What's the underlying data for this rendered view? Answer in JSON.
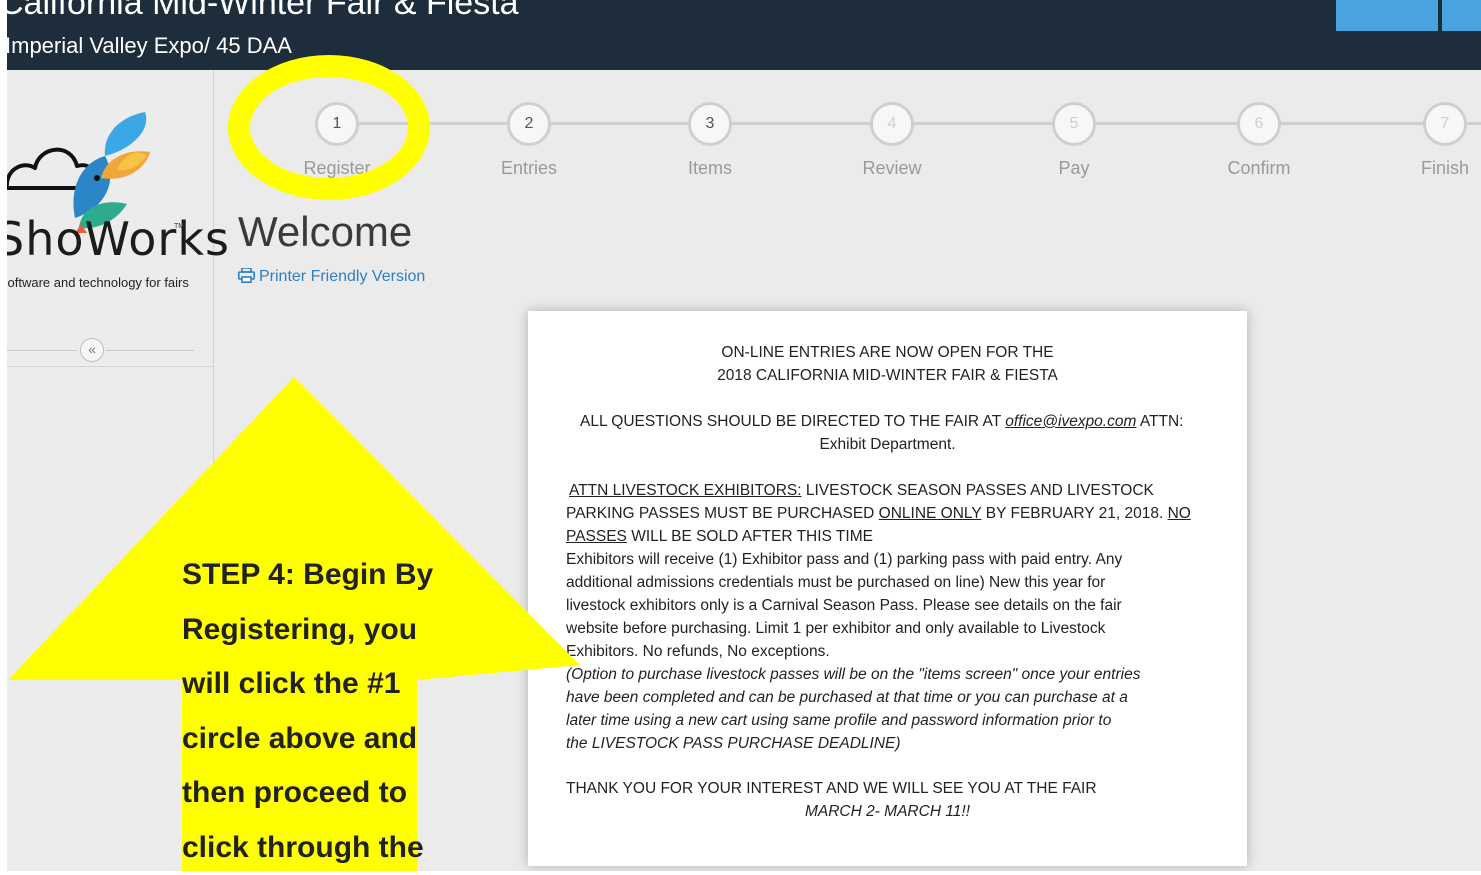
{
  "header": {
    "title": "California Mid-Winter Fair & Fiesta",
    "subtitle": "Imperial Valley Expo/ 45 DAA"
  },
  "sidebar": {
    "logo_wordmark": "ShoWorks",
    "logo_tm": "TM",
    "logo_tagline": "software and technology for fairs",
    "collapse_icon": "«"
  },
  "steps": [
    {
      "number": "1",
      "label": "Register"
    },
    {
      "number": "2",
      "label": "Entries"
    },
    {
      "number": "3",
      "label": "Items"
    },
    {
      "number": "4",
      "label": "Review"
    },
    {
      "number": "5",
      "label": "Pay"
    },
    {
      "number": "6",
      "label": "Confirm"
    },
    {
      "number": "7",
      "label": "Finish"
    }
  ],
  "main": {
    "heading": "Welcome",
    "printer_link": "Printer Friendly Version"
  },
  "notice": {
    "line1": "ON-LINE ENTRIES ARE NOW OPEN FOR THE",
    "line2": "2018 CALIFORNIA MID-WINTER FAIR & FIESTA",
    "questions_pre": "ALL QUESTIONS SHOULD BE DIRECTED TO THE FAIR AT ",
    "questions_email": "office@ivexpo.com",
    "questions_post": " ATTN:",
    "questions_line2": "Exhibit Department.",
    "livestock_heading": "ATTN LIVESTOCK EXHIBITORS:",
    "livestock_l1_rest": "  LIVESTOCK SEASON PASSES AND LIVESTOCK",
    "livestock_l2_pre": "PARKING PASSES MUST BE PURCHASED ",
    "livestock_l2_online": "ONLINE ONLY",
    "livestock_l2_mid": " BY FEBRUARY 21, 2018. ",
    "livestock_l2_no": "NO",
    "livestock_l3_passes": "PASSES",
    "livestock_l3_rest": " WILL BE SOLD AFTER THIS TIME",
    "exhibitors_l1": "Exhibitors will receive (1) Exhibitor pass and (1) parking pass with paid entry.  Any",
    "exhibitors_l2": "additional admissions credentials must be purchased on line) New this year for",
    "exhibitors_l3": "livestock exhibitors only is a Carnival Season Pass. Please see details on the fair",
    "exhibitors_l4": "website before purchasing. Limit 1 per exhibitor and only available to Livestock",
    "exhibitors_l5": "Exhibitors. No refunds, No exceptions.",
    "option_l1": "(Option to purchase livestock passes will be on the \"items screen\" once your entries",
    "option_l2": "have been completed and can be purchased at that time or you can purchase at a",
    "option_l3": "later time using a new cart using same profile and password information prior to",
    "option_l4": "the LIVESTOCK PASS PURCHASE DEADLINE)",
    "thanks": "THANK YOU FOR YOUR INTEREST AND WE WILL SEE YOU AT THE FAIR",
    "dates": "MARCH 2- MARCH 11!!"
  },
  "annotation": {
    "lines": [
      "STEP 4: Begin By",
      "Registering, you",
      "will click the #1",
      "circle above and",
      "then proceed to",
      "click through the"
    ]
  },
  "colors": {
    "header_bg": "#1e2d3b",
    "highlight_yellow": "#ffff00",
    "link_blue": "#2f7fc1",
    "header_button": "#4aa3df"
  }
}
